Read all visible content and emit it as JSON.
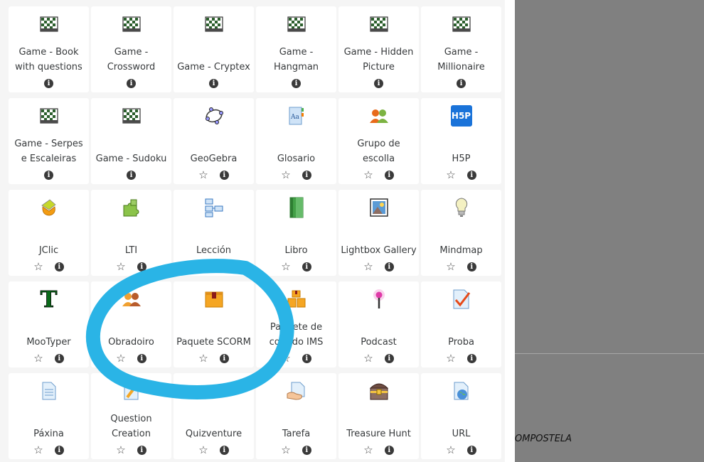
{
  "activities": [
    {
      "label": "Game - Book with questions",
      "icon": "game-board-icon",
      "star": false
    },
    {
      "label": "Game - Crossword",
      "icon": "game-board-icon",
      "star": false
    },
    {
      "label": "Game - Cryptex",
      "icon": "game-board-icon",
      "star": false
    },
    {
      "label": "Game - Hangman",
      "icon": "game-board-icon",
      "star": false
    },
    {
      "label": "Game - Hidden Picture",
      "icon": "game-board-icon",
      "star": false
    },
    {
      "label": "Game - Millionaire",
      "icon": "game-board-icon",
      "star": false
    },
    {
      "label": "Game - Serpes e Escaleiras",
      "icon": "game-board-icon",
      "star": false
    },
    {
      "label": "Game - Sudoku",
      "icon": "game-board-icon",
      "star": false
    },
    {
      "label": "GeoGebra",
      "icon": "geogebra-icon",
      "star": true
    },
    {
      "label": "Glosario",
      "icon": "glossary-icon",
      "star": true
    },
    {
      "label": "Grupo de escolla",
      "icon": "group-choice-icon",
      "star": true
    },
    {
      "label": "H5P",
      "icon": "h5p-icon",
      "star": true,
      "icon_text": "H5P"
    },
    {
      "label": "JClic",
      "icon": "jclic-icon",
      "star": true
    },
    {
      "label": "LTI",
      "icon": "puzzle-icon",
      "star": true
    },
    {
      "label": "Lección",
      "icon": "lesson-icon",
      "star": true
    },
    {
      "label": "Libro",
      "icon": "book-icon",
      "star": true
    },
    {
      "label": "Lightbox Gallery",
      "icon": "gallery-icon",
      "star": true
    },
    {
      "label": "Mindmap",
      "icon": "lightbulb-icon",
      "star": true
    },
    {
      "label": "MooTyper",
      "icon": "mootyper-icon",
      "star": true,
      "icon_text": "T"
    },
    {
      "label": "Obradoiro",
      "icon": "workshop-icon",
      "star": true
    },
    {
      "label": "Paquete SCORM",
      "icon": "scorm-package-icon",
      "star": true
    },
    {
      "label": "Paquete de contido IMS",
      "icon": "ims-package-icon",
      "star": true
    },
    {
      "label": "Podcast",
      "icon": "podcast-icon",
      "star": true
    },
    {
      "label": "Proba",
      "icon": "quiz-icon",
      "star": true
    },
    {
      "label": "Páxina",
      "icon": "page-icon",
      "star": true
    },
    {
      "label": "Question Creation",
      "icon": "question-creation-icon",
      "star": true
    },
    {
      "label": "Quizventure",
      "icon": "quizventure-icon",
      "star": true
    },
    {
      "label": "Tarefa",
      "icon": "assignment-icon",
      "star": true
    },
    {
      "label": "Treasure Hunt",
      "icon": "treasure-chest-icon",
      "star": true
    },
    {
      "label": "URL",
      "icon": "url-icon",
      "star": true
    }
  ],
  "star_glyph": "☆",
  "info_glyph": "i",
  "background": {
    "text": "OMPOSTELA"
  },
  "colors": {
    "annotation": "#2ab4e6",
    "card_bg": "#ffffff",
    "panel_bg": "#f5f5f5"
  }
}
